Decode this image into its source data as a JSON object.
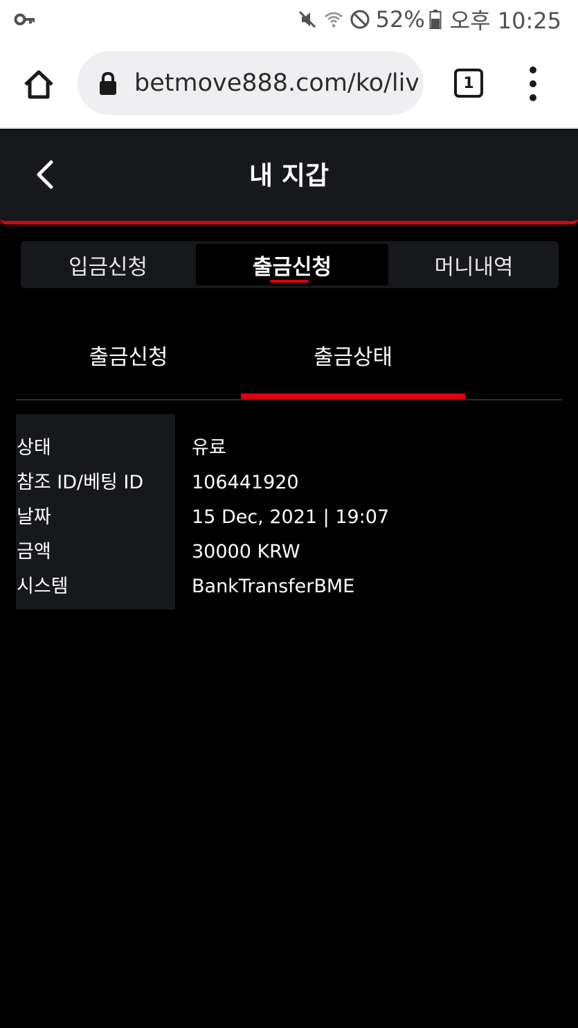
{
  "status_bar": {
    "battery": "52%",
    "time": "오후 10:25",
    "icons": [
      "key-icon",
      "mute-icon",
      "wifi-icon",
      "do-not-disturb-icon",
      "battery-icon"
    ]
  },
  "browser": {
    "url": "betmove888.com/ko/liv",
    "tab_count": "1"
  },
  "header": {
    "title": "내 지갑"
  },
  "main_tabs": [
    {
      "label": "입금신청",
      "active": false
    },
    {
      "label": "출금신청",
      "active": true
    },
    {
      "label": "머니내역",
      "active": false
    }
  ],
  "sub_tabs": [
    {
      "label": "출금신청",
      "active": false
    },
    {
      "label": "출금상태",
      "active": true
    }
  ],
  "details": [
    {
      "label": "상태",
      "value": "유료"
    },
    {
      "label": "참조 ID/베팅 ID",
      "value": "106441920"
    },
    {
      "label": "날짜",
      "value": "15 Dec, 2021 | 19:07"
    },
    {
      "label": "금액",
      "value": "30000 KRW"
    },
    {
      "label": "시스템",
      "value": "BankTransferBME"
    }
  ],
  "colors": {
    "accent": "#e0000f",
    "panel": "#17181c",
    "background": "#000000"
  }
}
